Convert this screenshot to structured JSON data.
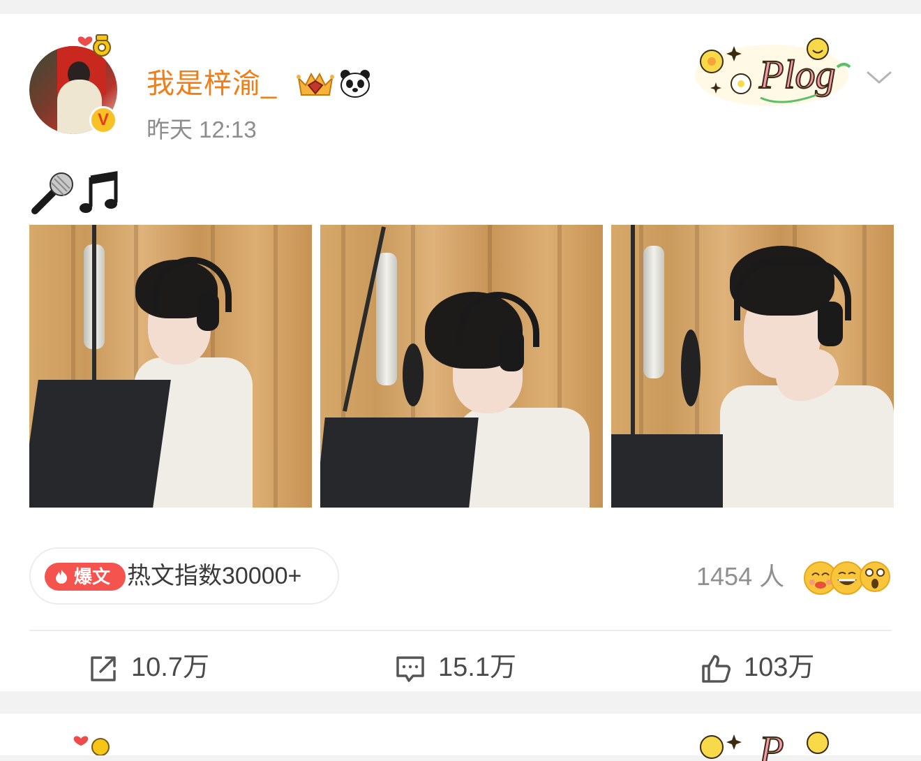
{
  "post": {
    "username": "我是梓渝_",
    "time": "昨天 12:13",
    "text_emojis": [
      "microphone",
      "music-note"
    ],
    "images_count": 3,
    "hot_badge": {
      "tag": "爆文",
      "text": "热文指数30000+"
    },
    "reactions": {
      "count_label": "1454 人"
    },
    "actions": {
      "repost": "10.7万",
      "comment": "15.1万",
      "like": "103万"
    }
  },
  "colors": {
    "username": "#f07d16",
    "hot_tag": "#f4534e",
    "verified": "#f8c226"
  }
}
